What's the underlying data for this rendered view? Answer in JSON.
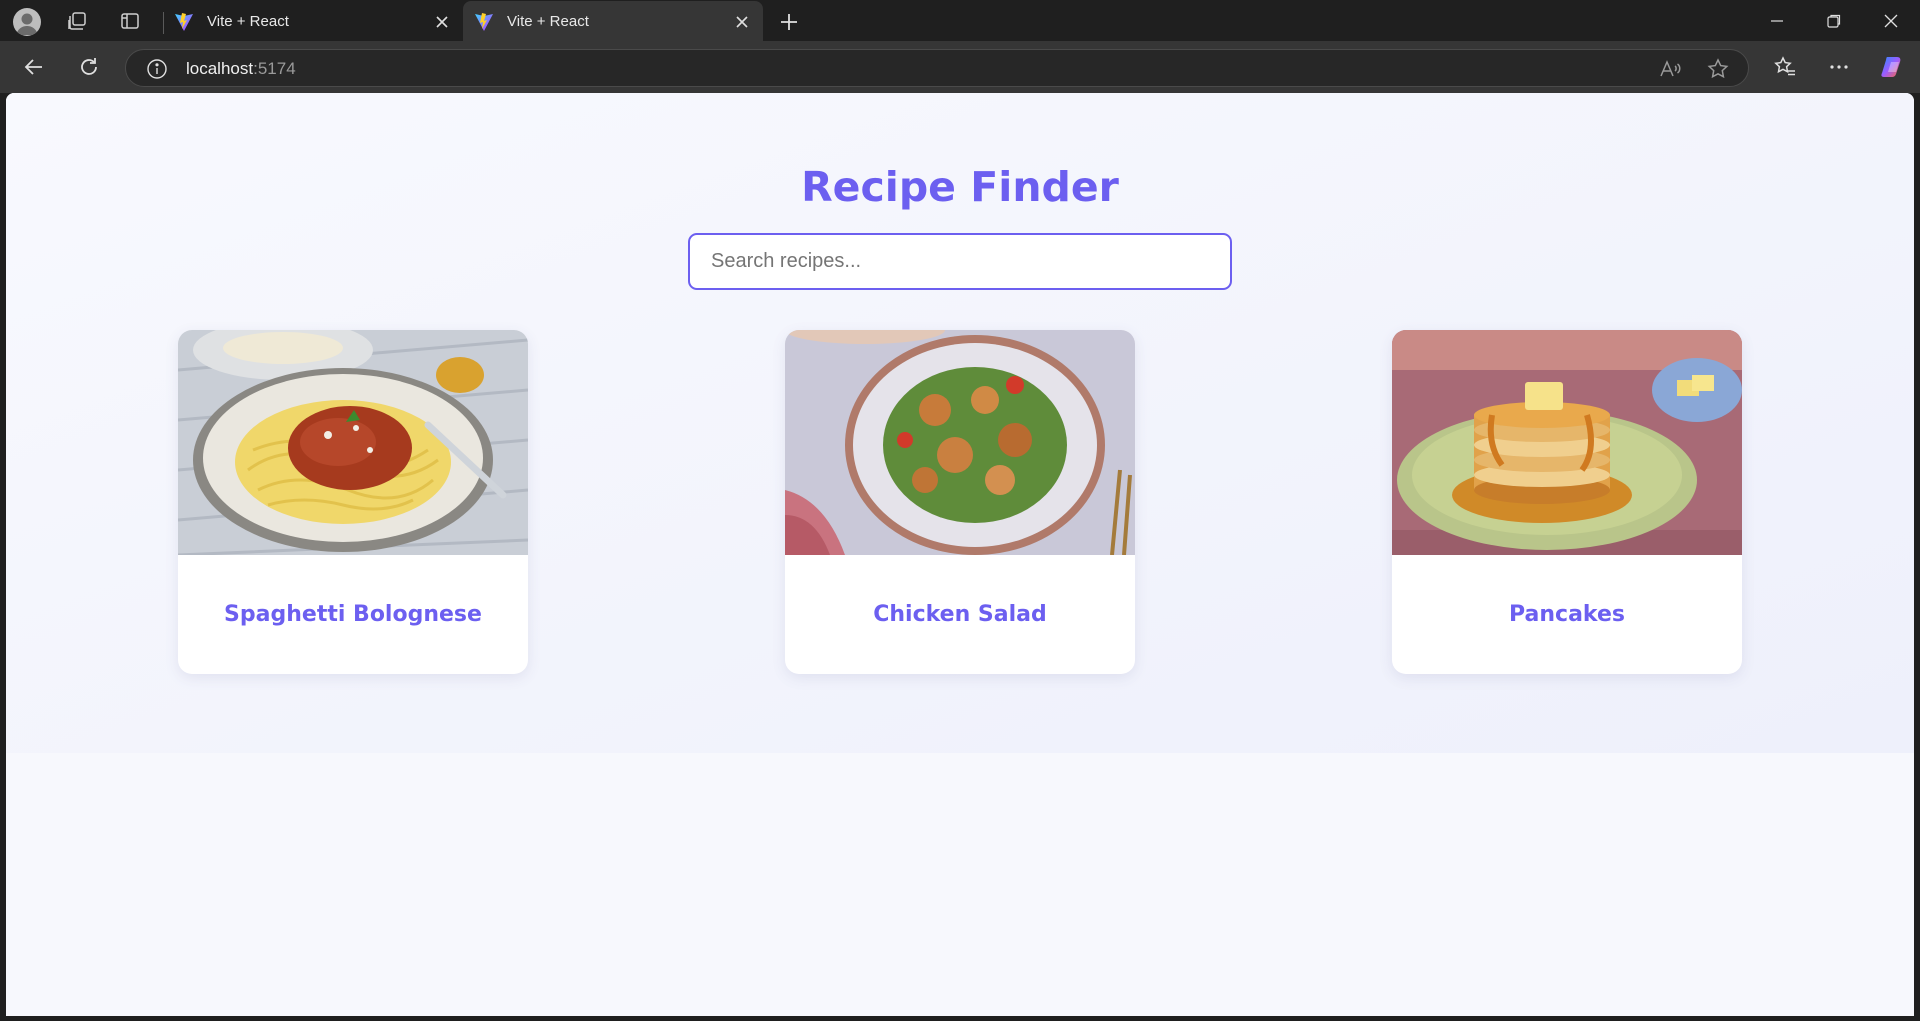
{
  "browser": {
    "tabs": [
      {
        "title": "Vite + React",
        "active": false
      },
      {
        "title": "Vite + React",
        "active": true
      }
    ],
    "address": {
      "host": "localhost",
      "port": ":5174"
    }
  },
  "app": {
    "title": "Recipe Finder",
    "search": {
      "placeholder": "Search recipes...",
      "value": ""
    },
    "accent_color": "#6c5ff0",
    "recipes": [
      {
        "name": "Spaghetti Bolognese",
        "image_icon": "spaghetti-photo"
      },
      {
        "name": "Chicken Salad",
        "image_icon": "salad-photo"
      },
      {
        "name": "Pancakes",
        "image_icon": "pancakes-photo"
      }
    ]
  }
}
